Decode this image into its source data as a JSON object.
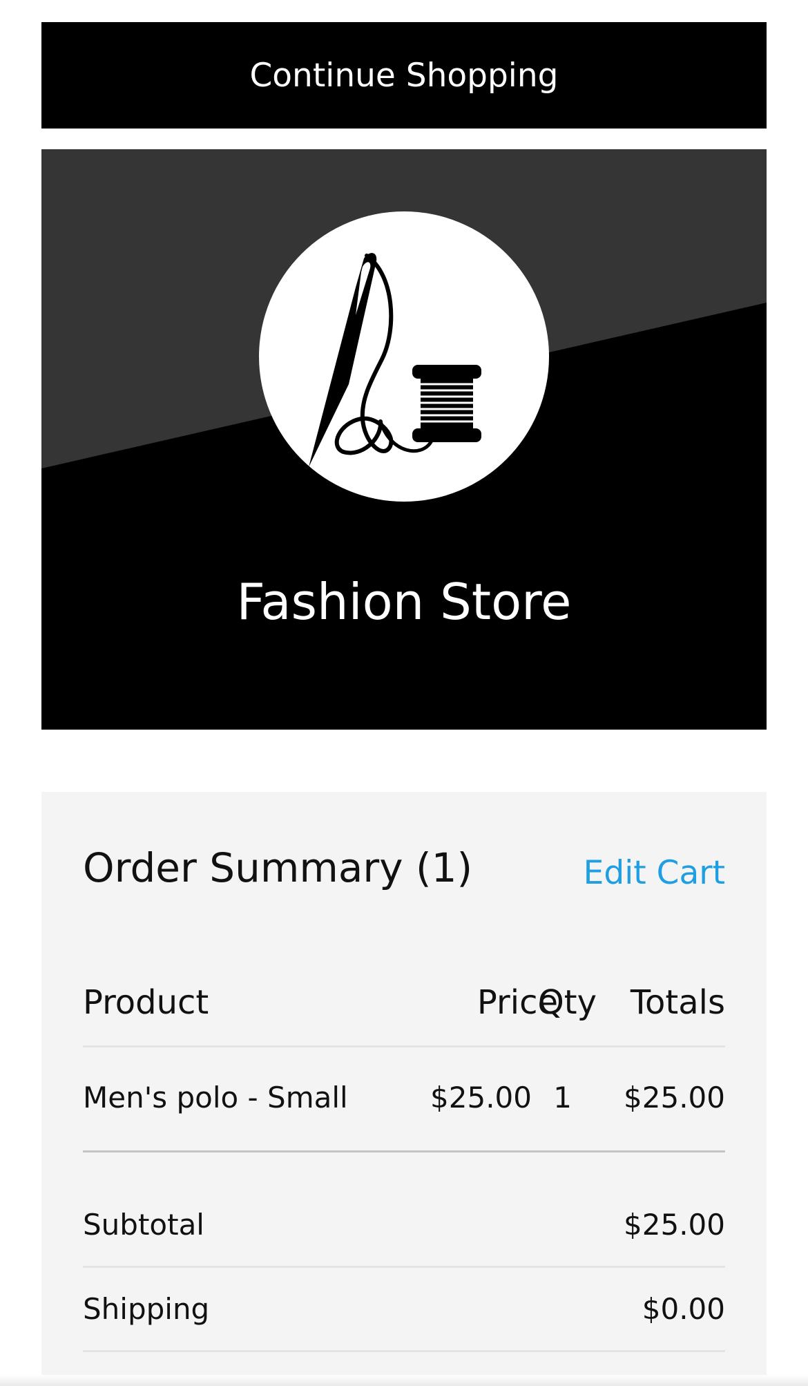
{
  "continue_shopping": {
    "label": "Continue Shopping"
  },
  "store": {
    "name": "Fashion Store",
    "logo_icon": "needle-and-thread-spool-icon"
  },
  "colors": {
    "header_bg": "#000000",
    "hero_light": "#353535",
    "accent_link": "#1f9ee2",
    "panel_bg": "#f4f4f4"
  },
  "order_summary": {
    "title": "Order Summary (1)",
    "edit_label": "Edit Cart",
    "columns": {
      "product": "Product",
      "price": "Price",
      "qty": "Qty",
      "totals": "Totals"
    },
    "items": [
      {
        "product": "Men's polo - Small",
        "price": "$25.00",
        "qty": "1",
        "total": "$25.00"
      }
    ],
    "subtotal_label": "Subtotal",
    "subtotal_value": "$25.00",
    "shipping_label": "Shipping",
    "shipping_value": "$0.00"
  }
}
